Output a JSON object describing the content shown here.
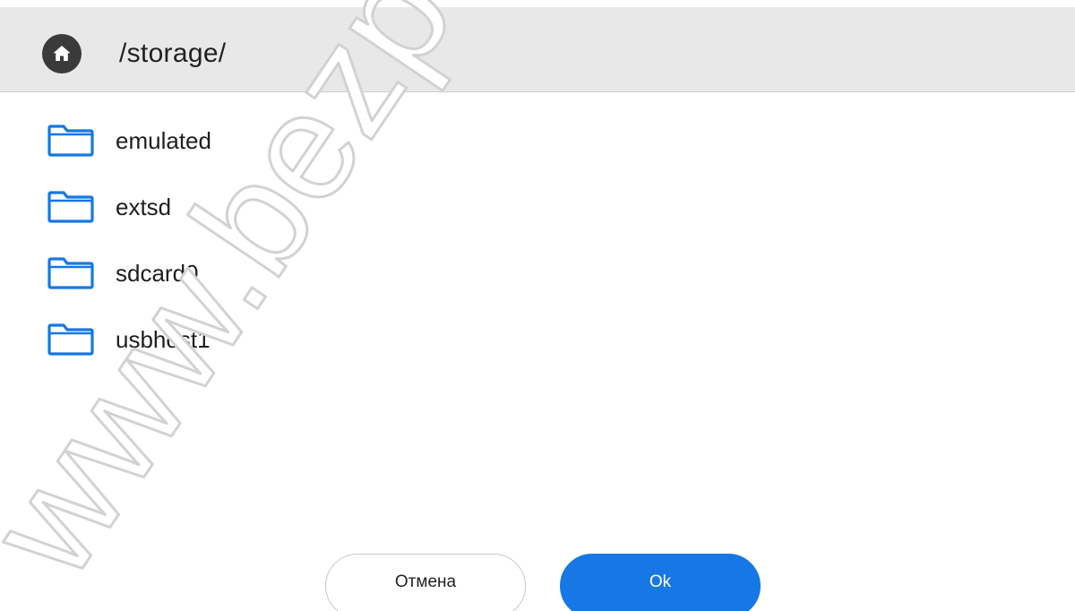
{
  "header": {
    "path": "/storage/",
    "home_icon": "home-icon"
  },
  "folders": [
    {
      "name": "emulated",
      "icon": "folder-icon"
    },
    {
      "name": "extsd",
      "icon": "folder-icon"
    },
    {
      "name": "sdcard0",
      "icon": "folder-icon"
    },
    {
      "name": "usbhost1",
      "icon": "folder-icon"
    }
  ],
  "actions": {
    "cancel_label": "Отмена",
    "ok_label": "Ok"
  },
  "watermark": {
    "text": "www.bezpeka-"
  },
  "colors": {
    "accent": "#1677e5",
    "header_bg": "#e8e8e8",
    "home_button": "#3a3a3a",
    "folder_outline": "#1677e5"
  }
}
